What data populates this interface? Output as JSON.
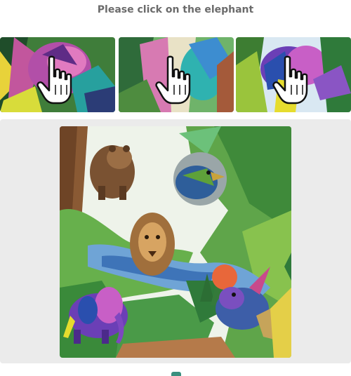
{
  "captcha": {
    "instruction": "Please click on the elephant",
    "thumbnails": [
      {
        "name": "thumbnail-1",
        "icon": "hand-pointer-icon"
      },
      {
        "name": "thumbnail-2",
        "icon": "hand-pointer-icon"
      },
      {
        "name": "thumbnail-3",
        "icon": "hand-pointer-icon"
      }
    ],
    "main_image_subjects": [
      "bear",
      "bird",
      "lion",
      "elephant",
      "rhinoceros"
    ]
  },
  "colors": {
    "panel_background": "#ebebeb",
    "instruction_text": "#6b6b6b"
  }
}
